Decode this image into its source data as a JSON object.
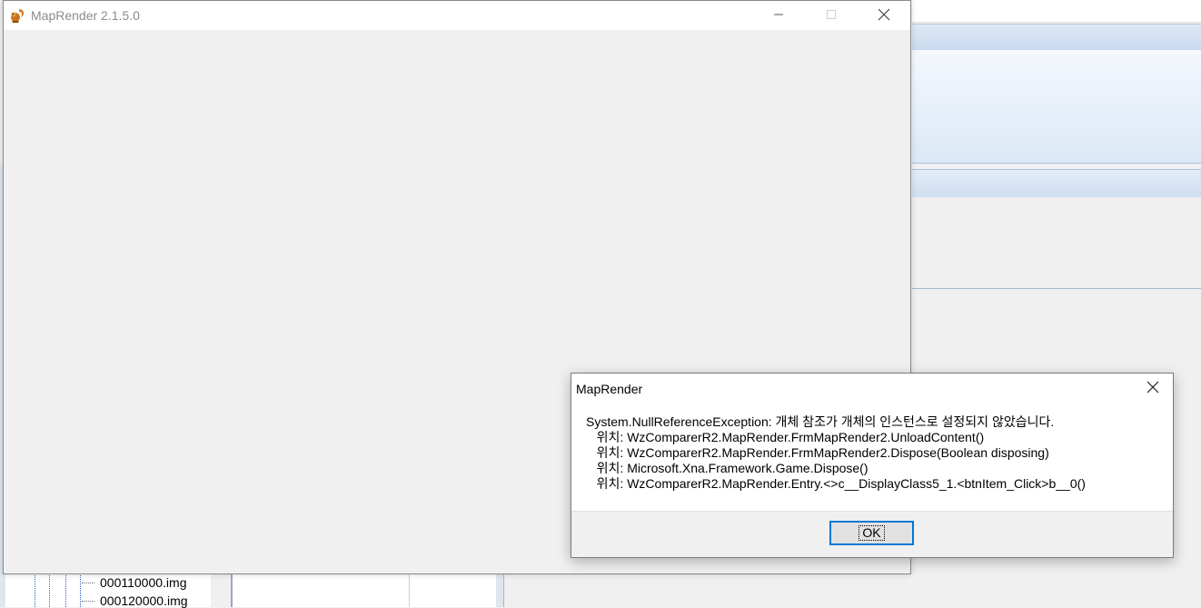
{
  "main_window": {
    "title": "MapRender 2.1.5.0",
    "icon": "squirrel-app-icon",
    "controls": {
      "minimize": "minimize-icon",
      "maximize": "maximize-icon",
      "close": "close-icon"
    }
  },
  "dialog": {
    "title": "MapRender",
    "close_icon": "close-icon",
    "message_lines": [
      "System.NullReferenceException: 개체 참조가 개체의 인스턴스로 설정되지 않았습니다.",
      "   위치: WzComparerR2.MapRender.FrmMapRender2.UnloadContent()",
      "   위치: WzComparerR2.MapRender.FrmMapRender2.Dispose(Boolean disposing)",
      "   위치: Microsoft.Xna.Framework.Game.Dispose()",
      "   위치: WzComparerR2.MapRender.Entry.<>c__DisplayClass5_1.<btnItem_Click>b__0()"
    ],
    "ok_label": "OK"
  },
  "background_app": {
    "tree_items": [
      "000110000.img",
      "000120000.img"
    ],
    "colors": {
      "ribbon": "#c9daf0",
      "tree_line": "#2a64c8",
      "accent": "#0078d7"
    }
  }
}
